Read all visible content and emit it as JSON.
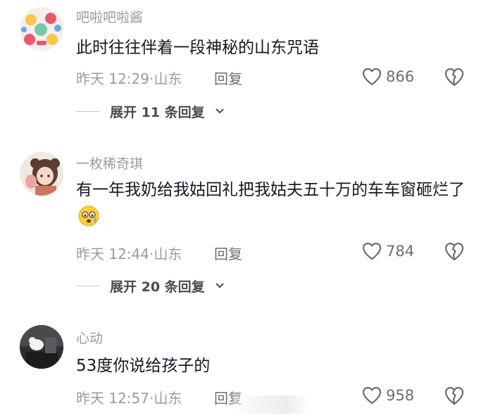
{
  "comments": [
    {
      "username": "吧啦吧啦酱",
      "text": "此时往往伴着一段神秘的山东咒语",
      "time": "昨天 12:29·山东",
      "reply_label": "回复",
      "likes": "866",
      "expand_label": "展开 11 条回复",
      "avatar_icon": "cartoon-sticker-avatar"
    },
    {
      "username": "一枚稀奇琪",
      "text": "有一年我奶给我姑回礼把我姑夫五十万的车车窗砸烂了",
      "emoji": "crying-face-emoji",
      "time": "昨天 12:44·山东",
      "reply_label": "回复",
      "likes": "784",
      "expand_label": "展开 20 条回复",
      "avatar_icon": "girl-illustration-avatar"
    },
    {
      "username": "心动",
      "text": "53度你说给孩子的",
      "time": "昨天 12:57·山东",
      "reply_label": "回复",
      "likes": "958",
      "avatar_icon": "photo-avatar"
    }
  ],
  "icons": {
    "like": "heart-icon",
    "dislike": "broken-heart-icon",
    "expand": "chevron-down-icon"
  }
}
